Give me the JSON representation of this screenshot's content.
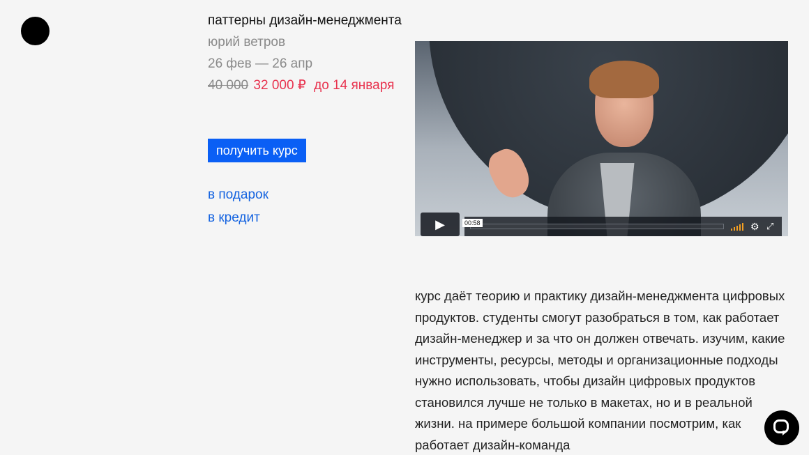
{
  "course": {
    "title": "паттерны дизайн-менеджмента",
    "author": "юрий ветров",
    "dates": "26 фев — 26 апр",
    "old_price": "40 000",
    "new_price": "32 000 ₽",
    "deadline": "до 14 января",
    "buy_label": "получить курс",
    "gift_link": "в подарок",
    "credit_link": "в кредит"
  },
  "video": {
    "time_tooltip": "00:58",
    "play_icon": "play-icon",
    "settings_icon": "gear-icon",
    "fullscreen_icon": "fullscreen-icon",
    "volume_color": "#f4a023"
  },
  "description": "курс даёт теорию и практику дизайн-менеджмента цифровых продуктов. студенты смогут разобраться в том, как работает дизайн-менеджер и за что он должен отвечать. изучим, какие инструменты, ресурсы, методы и организационные подходы нужно использовать, чтобы дизайн цифровых продуктов становился лучше не только в макетах, но и в реальной жизни. на примере большой компании посмотрим, как работает дизайн-команда",
  "colors": {
    "accent_blue": "#0a5ff5",
    "link_blue": "#1463e0",
    "price_red": "#e8334f",
    "muted_gray": "#8a8a8a",
    "background": "#f5f5f5"
  }
}
